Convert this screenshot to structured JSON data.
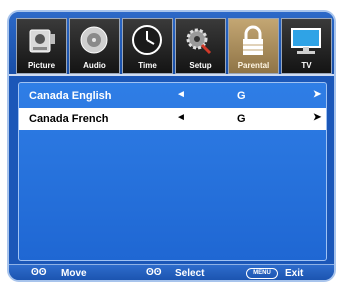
{
  "tabs": [
    {
      "label": "Picture",
      "icon": "picture-icon",
      "active": false
    },
    {
      "label": "Audio",
      "icon": "audio-icon",
      "active": false
    },
    {
      "label": "Time",
      "icon": "clock-icon",
      "active": false
    },
    {
      "label": "Setup",
      "icon": "gear-icon",
      "active": false
    },
    {
      "label": "Parental",
      "icon": "lock-icon",
      "active": true
    },
    {
      "label": "TV",
      "icon": "tv-icon",
      "active": false
    }
  ],
  "ratings": [
    {
      "name": "Canada English",
      "value": "G",
      "left_arrow": "◄",
      "right_arrow": "➤",
      "selected": false
    },
    {
      "name": "Canada French",
      "value": "G",
      "left_arrow": "◄",
      "right_arrow": "➤",
      "selected": true
    }
  ],
  "hints": {
    "move_icon": "ʘʘ",
    "move_label": "Move",
    "select_icon": "ʘʘ",
    "select_label": "Select",
    "menu_key": "MENU",
    "exit_label": "Exit"
  },
  "colors": {
    "frame_blue": "#1b57b8",
    "content_blue": "#2f7ee6",
    "active_tab_gold": "#c3a673",
    "selected_row": "#ffffff"
  }
}
